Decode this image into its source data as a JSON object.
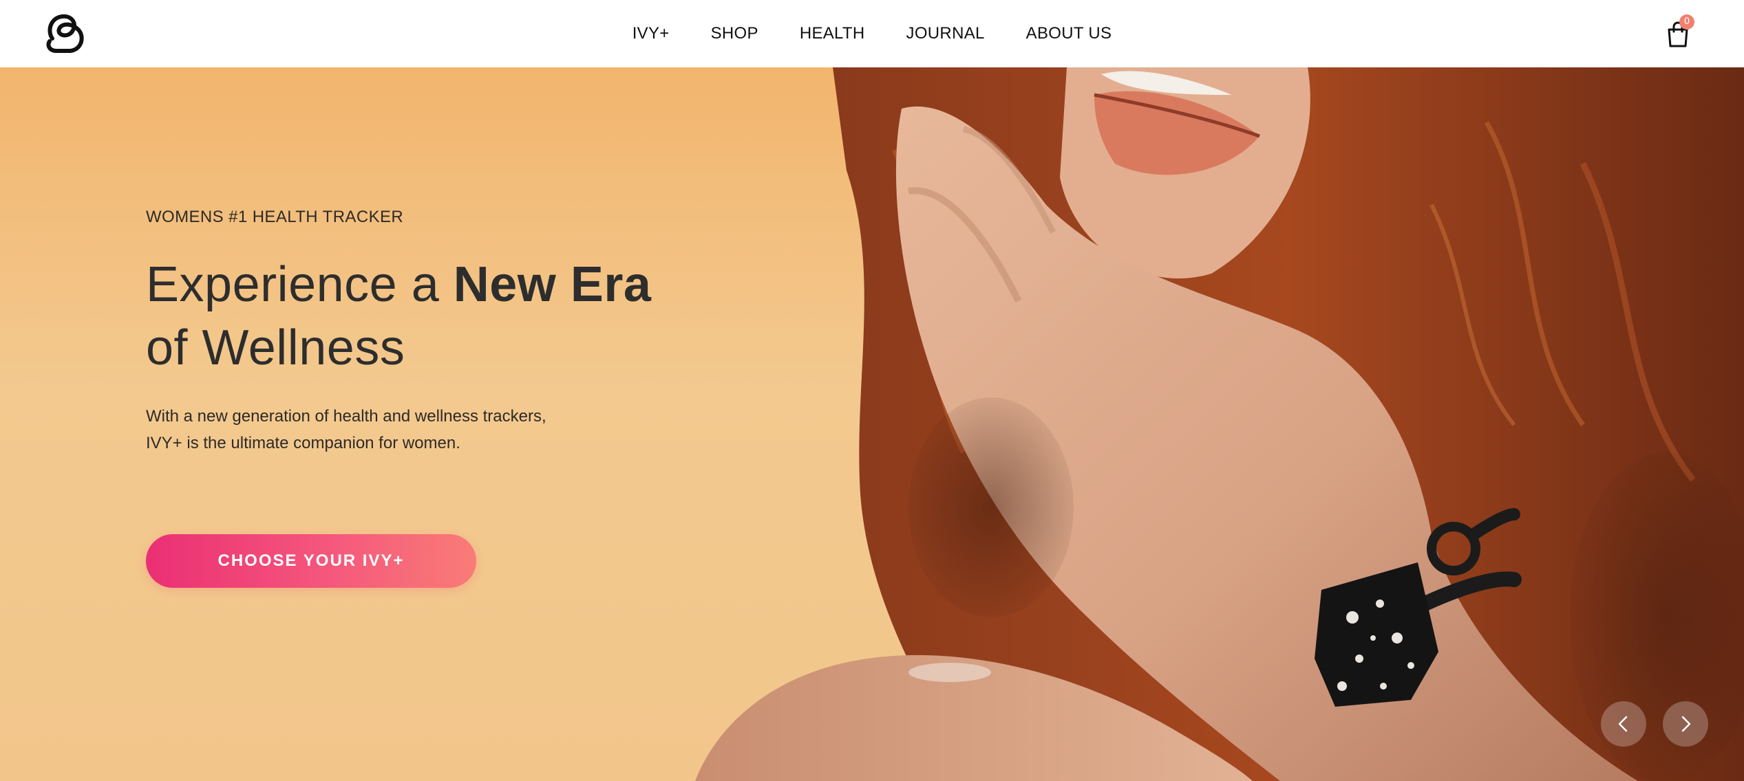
{
  "header": {
    "logo": "ivy-logo",
    "nav": [
      {
        "label": "IVY+"
      },
      {
        "label": "SHOP"
      },
      {
        "label": "HEALTH"
      },
      {
        "label": "JOURNAL"
      },
      {
        "label": "ABOUT US"
      }
    ],
    "cart": {
      "icon": "shopping-bag-icon",
      "count": "0"
    }
  },
  "hero": {
    "eyebrow": "WOMENS #1 HEALTH TRACKER",
    "headline": {
      "line1_regular": "Experience a ",
      "line1_bold": "New Era",
      "line2": "of Wellness"
    },
    "subtext": {
      "line1": "With a new generation of health and wellness trackers,",
      "line2": "IVY+ is the ultimate companion for women."
    },
    "cta_label": "CHOOSE YOUR IVY+",
    "slider": {
      "prev_icon": "chevron-left-icon",
      "next_icon": "chevron-right-icon"
    }
  },
  "colors": {
    "accent_start": "#ea2f74",
    "accent_end": "#f97c77",
    "hero_background": "#f3c98f",
    "cart_badge": "#f08070",
    "text_dark": "#2d2d2d"
  }
}
